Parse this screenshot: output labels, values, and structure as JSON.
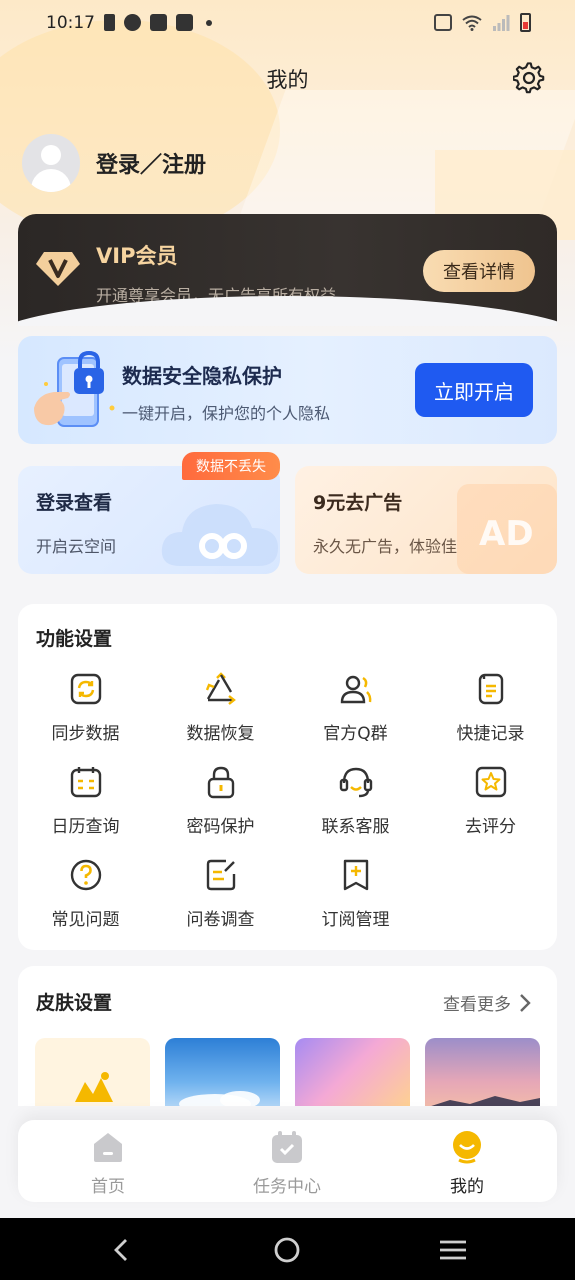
{
  "status_bar": {
    "time": "10:17",
    "left_icons": [
      "notification-icon",
      "compass-icon",
      "shopping-bag-icon",
      "shopping-bag-icon",
      "dot-icon"
    ],
    "right_icons": [
      "vibrate-icon",
      "wifi-icon",
      "signal-icon",
      "battery-low-icon"
    ]
  },
  "header": {
    "title": "我的",
    "settings_icon": "gear-icon"
  },
  "profile": {
    "login_label": "登录／注册"
  },
  "vip": {
    "title": "VIP会员",
    "subtitle": "开通尊享会员，无广告享所有权益",
    "button_label": "查看详情",
    "accent": "#f6d4a0"
  },
  "privacy": {
    "title": "数据安全隐私保护",
    "subtitle": "一键开启，保护您的个人隐私",
    "button_label": "立即开启",
    "button_color": "#1f5af1"
  },
  "promo": {
    "tag": "数据不丢失",
    "cloud": {
      "title": "登录查看",
      "subtitle": "开启云空间"
    },
    "ad": {
      "title": "9元去广告",
      "subtitle": "永久无广告，体验佳",
      "watermark": "AD"
    }
  },
  "functions": {
    "title": "功能设置",
    "items": [
      {
        "label": "同步数据",
        "icon": "sync-icon"
      },
      {
        "label": "数据恢复",
        "icon": "recycle-icon"
      },
      {
        "label": "官方Q群",
        "icon": "group-icon"
      },
      {
        "label": "快捷记录",
        "icon": "notes-icon"
      },
      {
        "label": "日历查询",
        "icon": "calendar-icon"
      },
      {
        "label": "密码保护",
        "icon": "lock-icon"
      },
      {
        "label": "联系客服",
        "icon": "headset-icon"
      },
      {
        "label": "去评分",
        "icon": "star-icon"
      },
      {
        "label": "常见问题",
        "icon": "question-icon"
      },
      {
        "label": "问卷调查",
        "icon": "survey-icon"
      },
      {
        "label": "订阅管理",
        "icon": "subscribe-icon"
      }
    ]
  },
  "skins": {
    "title": "皮肤设置",
    "more_label": "查看更多"
  },
  "tabbar": {
    "items": [
      {
        "label": "首页",
        "icon": "home-icon",
        "active": false
      },
      {
        "label": "任务中心",
        "icon": "task-calendar-icon",
        "active": false
      },
      {
        "label": "我的",
        "icon": "mine-icon",
        "active": true
      }
    ]
  },
  "colors": {
    "accent_yellow": "#f5b800",
    "primary_blue": "#1f5af1",
    "tag_orange": "#ff6a3d"
  }
}
